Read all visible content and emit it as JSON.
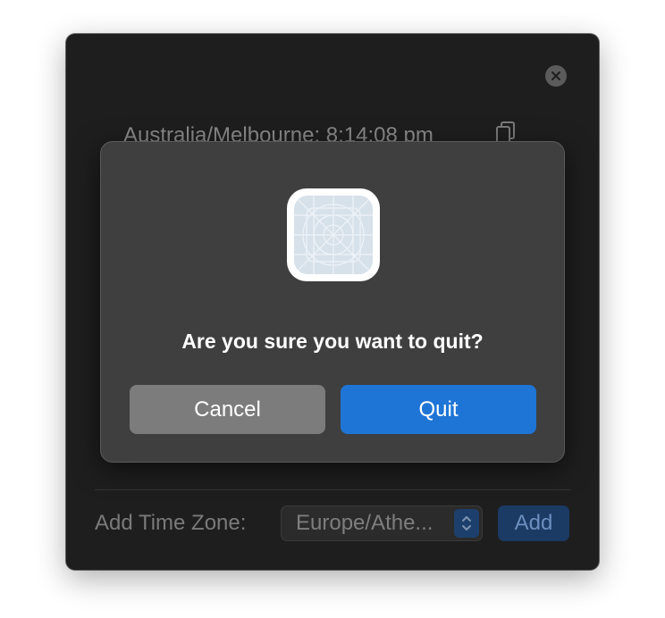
{
  "window": {
    "timezone_line": "Australia/Melbourne: 8:14:08 pm",
    "add_timezone_label": "Add Time Zone:",
    "timezone_select_value": "Europe/Athe...",
    "add_button_label": "Add"
  },
  "dialog": {
    "message": "Are you sure you want to quit?",
    "cancel_label": "Cancel",
    "quit_label": "Quit"
  },
  "colors": {
    "window_bg": "#1e1e1e",
    "dialog_bg": "#3f3f3f",
    "cancel_bg": "#7c7c7c",
    "quit_bg": "#1f75d6"
  },
  "icons": {
    "close": "close-icon",
    "copy": "copy-icon",
    "app": "app-placeholder-icon",
    "stepper": "chevron-up-down-icon"
  }
}
